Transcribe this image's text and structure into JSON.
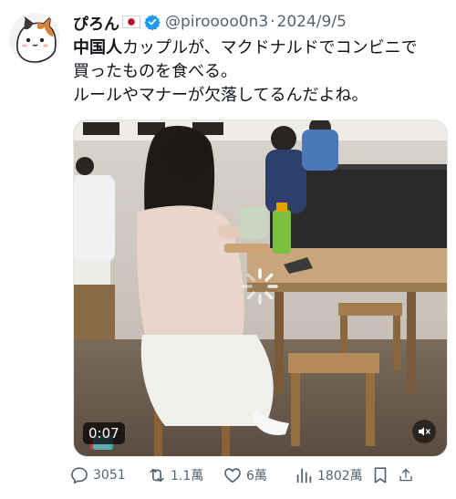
{
  "tweet": {
    "display_name": "ぴろん",
    "handle": "@piroooo0n3",
    "separator": "·",
    "date": "2024/9/5",
    "text_lines": [
      {
        "lead": "中国人",
        "rest": "カップルが、マクドナルドでコンビニで"
      },
      {
        "lead": "",
        "rest": "買ったものを食べる。"
      },
      {
        "lead": "",
        "rest": "ルールやマナーが欠落してるんだよね。"
      }
    ]
  },
  "media": {
    "duration": "0:07",
    "kind": "video"
  },
  "actions": {
    "replies": "3051",
    "retweets": "1.1萬",
    "likes": "6萬",
    "views": "1802萬"
  },
  "icons": {
    "flag": "japan-flag-icon",
    "verified": "verified-badge-icon",
    "reply": "reply-icon",
    "retweet": "retweet-icon",
    "like": "heart-icon",
    "views": "views-chart-icon",
    "bookmark": "bookmark-icon",
    "share": "share-icon",
    "mute": "muted-speaker-icon",
    "spinner": "loading-spinner-icon"
  },
  "colors": {
    "verified": "#1d9bf0",
    "secondary_text": "#536471",
    "primary_text": "#0f1419",
    "flag_red": "#bc002d"
  }
}
